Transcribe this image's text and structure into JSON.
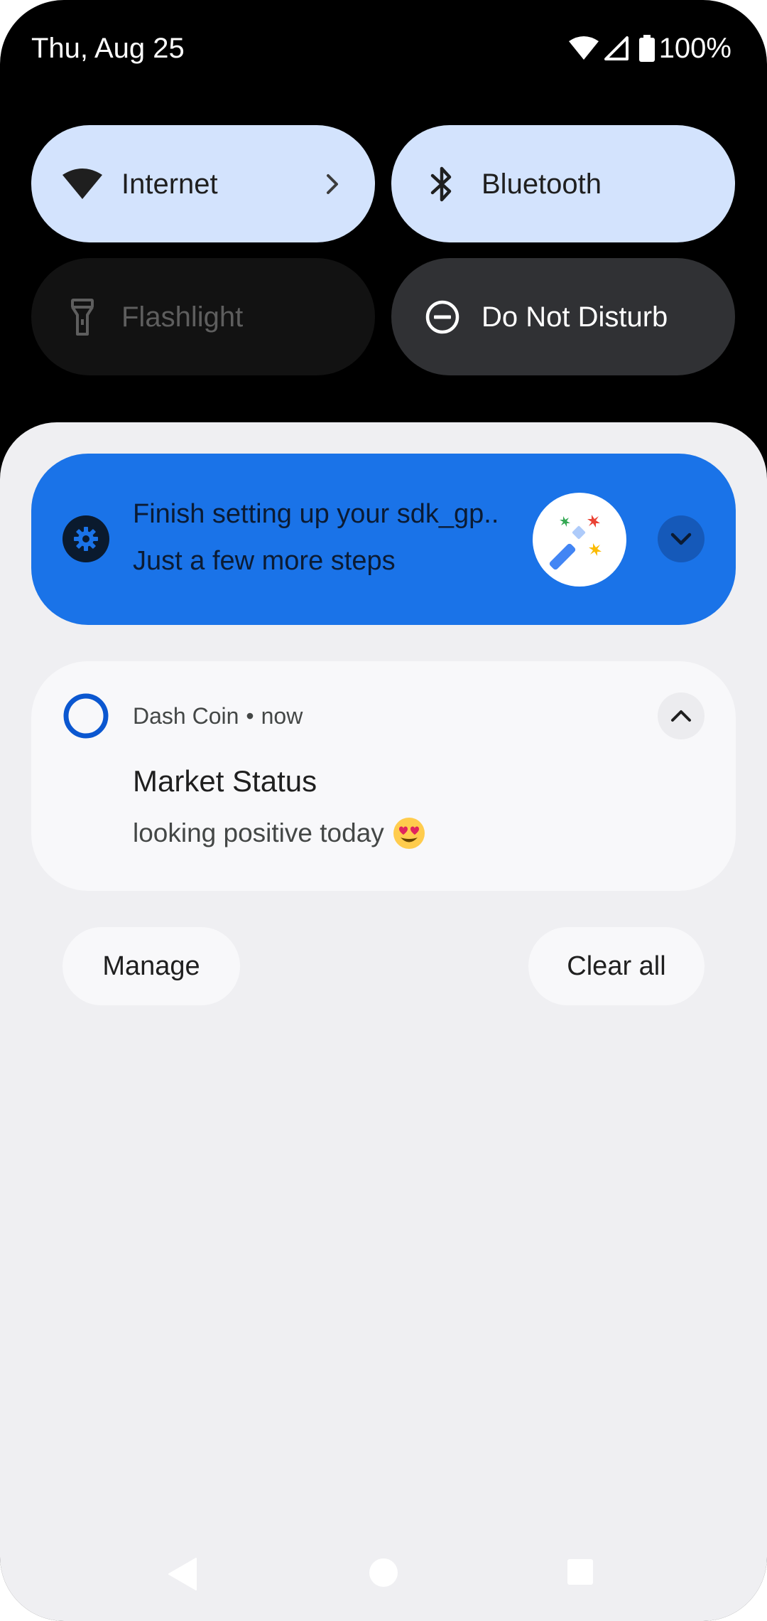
{
  "status_bar": {
    "date": "Thu, Aug 25",
    "battery": "100%",
    "icons": [
      "wifi-icon",
      "cell-signal-icon",
      "battery-icon"
    ]
  },
  "quick_settings": {
    "tiles": [
      {
        "label": "Internet",
        "icon": "wifi-icon",
        "state": "on",
        "has_chevron": true
      },
      {
        "label": "Bluetooth",
        "icon": "bluetooth-icon",
        "state": "on"
      },
      {
        "label": "Flashlight",
        "icon": "flashlight-icon",
        "state": "unavailable"
      },
      {
        "label": "Do Not Disturb",
        "icon": "do-not-disturb-icon",
        "state": "off"
      }
    ]
  },
  "notifications": {
    "setup": {
      "title": "Finish setting up your sdk_gp..",
      "subtitle": "Just a few more steps",
      "icon": "gear-icon",
      "image": "magic-wand-icon",
      "expand_icon": "chevron-down-icon"
    },
    "dash": {
      "app": "Dash Coin",
      "separator": "•",
      "time": "now",
      "title": "Market Status",
      "body": "looking positive today",
      "emoji": "heart-eyes-emoji",
      "collapse_icon": "chevron-up-icon"
    }
  },
  "actions": {
    "manage": "Manage",
    "clear_all": "Clear all"
  },
  "nav_bar": {
    "buttons": [
      "back-icon",
      "home-icon",
      "recents-icon"
    ]
  },
  "colors": {
    "tile_active": "#d3e3fd",
    "tile_dnd": "#303134",
    "setup_notification": "#1a73e8",
    "shade_background": "#efeff2",
    "card_background": "#f8f8fa"
  }
}
